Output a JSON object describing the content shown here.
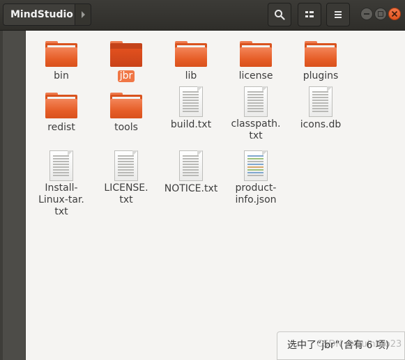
{
  "header": {
    "path_label": "MindStudio",
    "accent_color": "#e95420"
  },
  "items": [
    {
      "name": "bin",
      "type": "folder",
      "selected": false
    },
    {
      "name": "jbr",
      "type": "folder",
      "selected": true
    },
    {
      "name": "lib",
      "type": "folder",
      "selected": false
    },
    {
      "name": "license",
      "type": "folder",
      "selected": false
    },
    {
      "name": "plugins",
      "type": "folder",
      "selected": false
    },
    {
      "name": "redist",
      "type": "folder",
      "selected": false
    },
    {
      "name": "tools",
      "type": "folder",
      "selected": false
    },
    {
      "name": "build.txt",
      "type": "text",
      "selected": false
    },
    {
      "name": "classpath.\ntxt",
      "type": "text",
      "selected": false
    },
    {
      "name": "icons.db",
      "type": "text",
      "selected": false
    },
    {
      "name": "Install-\nLinux-tar.\ntxt",
      "type": "text",
      "selected": false
    },
    {
      "name": "LICENSE.\ntxt",
      "type": "text",
      "selected": false
    },
    {
      "name": "NOTICE.txt",
      "type": "text",
      "selected": false
    },
    {
      "name": "product-\ninfo.json",
      "type": "code",
      "selected": false
    }
  ],
  "status": {
    "text": "选中了“jbr”(含有 6 项)",
    "watermark": "CSDN @Quinbro23"
  }
}
